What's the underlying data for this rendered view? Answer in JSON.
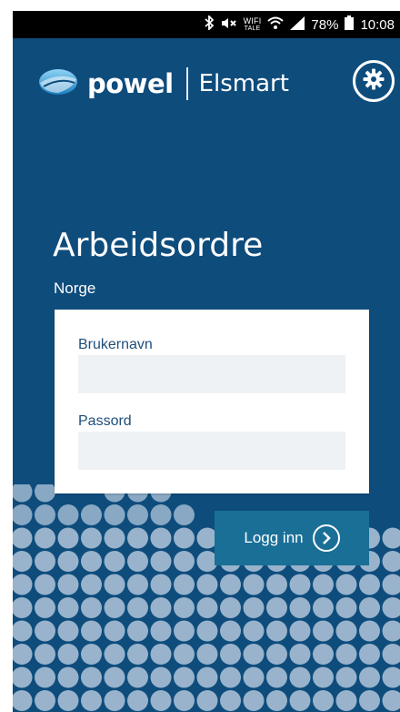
{
  "status_bar": {
    "wifi_tag_top": "WIFI",
    "wifi_tag_bottom": "TALE",
    "battery": "78%",
    "time": "10:08",
    "icons": [
      "bluetooth-icon",
      "mute-icon",
      "wifi-icon",
      "signal-icon",
      "battery-icon"
    ]
  },
  "header": {
    "logo_text": "powel",
    "product": "Elsmart",
    "settings_icon": "gear-icon"
  },
  "main": {
    "title": "Arbeidsordre",
    "region": "Norge"
  },
  "login": {
    "username_label": "Brukernavn",
    "username_value": "",
    "password_label": "Passord",
    "password_value": "",
    "submit_label": "Logg inn",
    "submit_icon": "chevron-right-circle-icon"
  },
  "colors": {
    "background": "#0e4c7c",
    "button": "#1a6f97",
    "input_bg": "#eef2f5",
    "label": "#1d4f7a",
    "dot": "#a7bfd4"
  }
}
